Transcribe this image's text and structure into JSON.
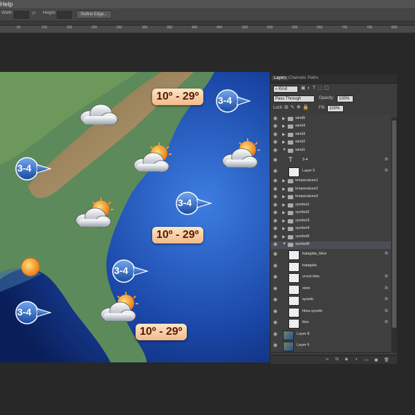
{
  "menu": {
    "help_label": "Help"
  },
  "options_bar": {
    "width_label": "Width:",
    "height_label": "Height:",
    "swap_icon": "swap-icon",
    "refine_edge_label": "Refine Edge..."
  },
  "ruler": {
    "ticks": [
      "50",
      "100",
      "150",
      "200",
      "250",
      "300",
      "350",
      "400",
      "450",
      "500",
      "550",
      "600",
      "650",
      "700",
      "750",
      "800"
    ]
  },
  "map": {
    "temp_labels": [
      "10º - 29º",
      "10º - 29º",
      "10º - 29º"
    ],
    "wind_labels": [
      "3-4",
      "3-4",
      "3-4",
      "3-4",
      "3-4"
    ],
    "colors": {
      "ocean": "#1a47a8",
      "land": "#5d8a5a",
      "bubble": "#2a5fb8",
      "label_text": "#5a1805"
    }
  },
  "layers_panel": {
    "tabs": [
      "Layers",
      "Channels",
      "Paths"
    ],
    "kind_label": "Kind",
    "blend_mode": "Pass Through",
    "opacity_label": "Opacity:",
    "opacity_value": "100%",
    "lock_label": "Lock:",
    "fill_label": "Fill:",
    "fill_value": "100%",
    "layers": [
      {
        "name": "wind5",
        "type": "group"
      },
      {
        "name": "wind4",
        "type": "group"
      },
      {
        "name": "wind3",
        "type": "group"
      },
      {
        "name": "wind2",
        "type": "group"
      },
      {
        "name": "wind1",
        "type": "group-open"
      },
      {
        "name": "3-4",
        "type": "text",
        "fx": "fx"
      },
      {
        "name": "Layer 5",
        "type": "pixel",
        "fx": "fx"
      },
      {
        "name": "temperature1",
        "type": "group"
      },
      {
        "name": "temperature2",
        "type": "group"
      },
      {
        "name": "temperature3",
        "type": "group"
      },
      {
        "name": "symbol1",
        "type": "group"
      },
      {
        "name": "symbol2",
        "type": "group"
      },
      {
        "name": "symbol3",
        "type": "group"
      },
      {
        "name": "symbol4",
        "type": "group"
      },
      {
        "name": "symbol5",
        "type": "group"
      },
      {
        "name": "symbol6",
        "type": "group-open-selected"
      },
      {
        "name": "katagida_hlios",
        "type": "pixel",
        "fx": "fx"
      },
      {
        "name": "katagida",
        "type": "pixel",
        "fx": ""
      },
      {
        "name": "vrroxi-ilios",
        "type": "pixel",
        "fx": "fx"
      },
      {
        "name": "xioni",
        "type": "pixel",
        "fx": "fx"
      },
      {
        "name": "synefo",
        "type": "pixel",
        "fx": "fx"
      },
      {
        "name": "hlios-synefo",
        "type": "pixel",
        "fx": "fx"
      },
      {
        "name": "ilios",
        "type": "pixel",
        "fx": "fx"
      },
      {
        "name": "Layer 8",
        "type": "image",
        "fx": ""
      },
      {
        "name": "Layer 6",
        "type": "image",
        "fx": ""
      }
    ],
    "footer_icons": [
      "link-icon",
      "fx-icon",
      "mask-icon",
      "adjustment-icon",
      "folder-icon",
      "new-layer-icon",
      "trash-icon"
    ]
  }
}
